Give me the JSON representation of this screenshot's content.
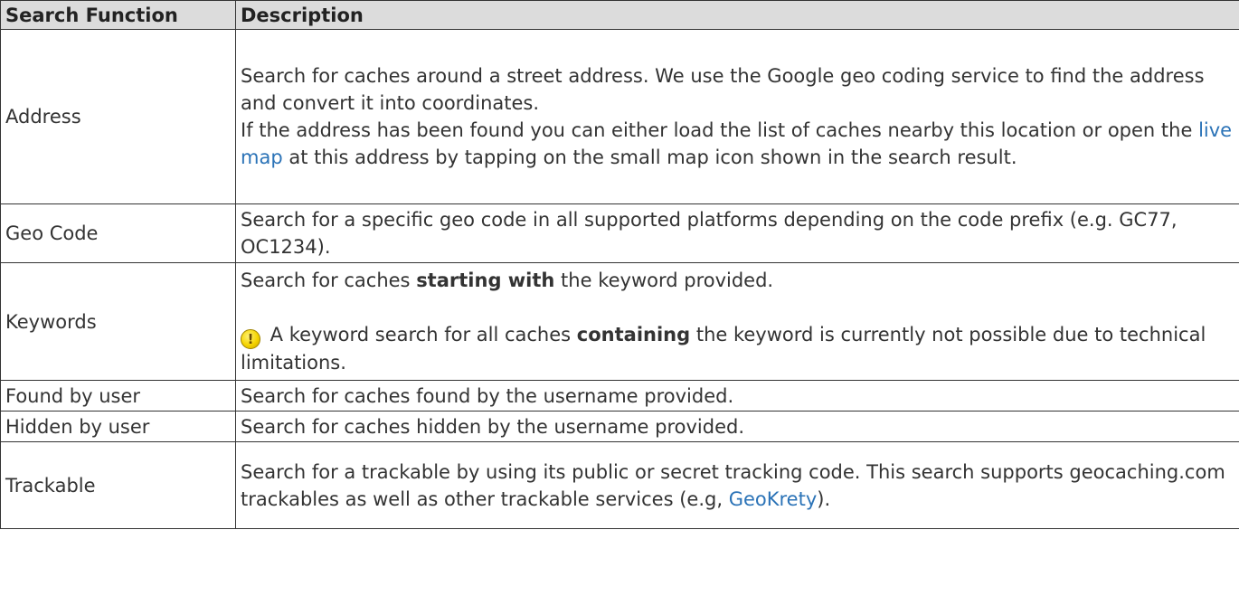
{
  "table": {
    "headers": {
      "col1": "Search Function",
      "col2": "Description"
    },
    "rows": {
      "address": {
        "name": "Address",
        "line1": "Search for caches around a street address. We use the Google geo coding service to find the address and convert it into coordinates.",
        "line2_pre": "If the address has been found you can either load the list of caches nearby this location or open the ",
        "link": "live map",
        "line2_post": " at this address by tapping on the small map icon shown in the search result."
      },
      "geocode": {
        "name": "Geo Code",
        "text": "Search for a specific geo code in all supported platforms depending on the code prefix (e.g. GC77, OC1234)."
      },
      "keywords": {
        "name": "Keywords",
        "p1_pre": "Search for caches ",
        "p1_bold": "starting with",
        "p1_post": " the keyword provided.",
        "icon_glyph": "!",
        "p2_pre": " A keyword search for all caches ",
        "p2_bold": "containing",
        "p2_post": " the keyword is currently not possible due to technical limitations."
      },
      "found": {
        "name": "Found by user",
        "text": "Search for caches found by the username provided."
      },
      "hidden": {
        "name": "Hidden by user",
        "text": "Search for caches hidden by the username provided."
      },
      "trackable": {
        "name": "Trackable",
        "pre": "Search for a trackable by using its public or secret tracking code. This search supports geocaching.com trackables as well as other trackable services (e.g, ",
        "link": "GeoKrety",
        "post": ")."
      }
    }
  }
}
